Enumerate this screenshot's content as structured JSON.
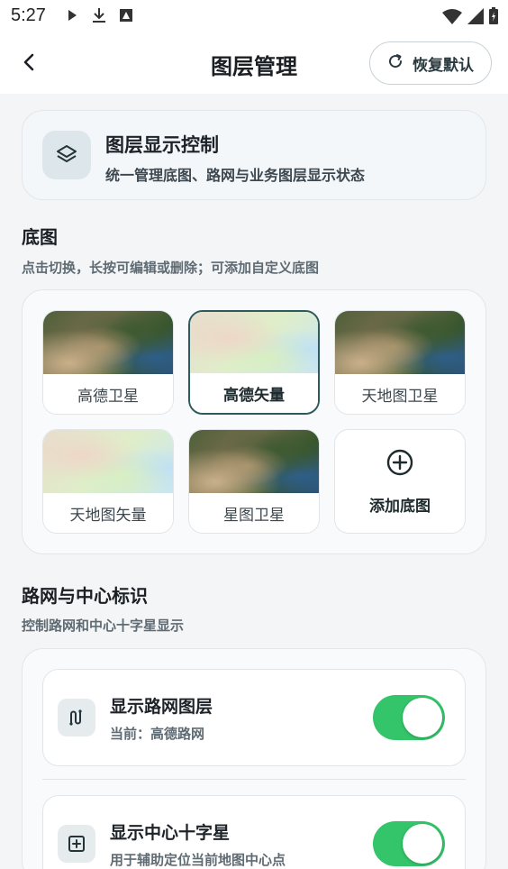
{
  "status_bar": {
    "time": "5:27"
  },
  "app_bar": {
    "title": "图层管理",
    "reset_label": "恢复默认"
  },
  "hero": {
    "title": "图层显示控制",
    "subtitle": "统一管理底图、路网与业务图层显示状态"
  },
  "basemap_section": {
    "title": "底图",
    "subtitle": "点击切换，长按可编辑或删除；可添加自定义底图",
    "tiles": [
      {
        "label": "高德卫星",
        "style": "satellite",
        "selected": false
      },
      {
        "label": "高德矢量",
        "style": "vector",
        "selected": true
      },
      {
        "label": "天地图卫星",
        "style": "satellite",
        "selected": false
      },
      {
        "label": "天地图矢量",
        "style": "vector",
        "selected": false
      },
      {
        "label": "星图卫星",
        "style": "satellite",
        "selected": false
      }
    ],
    "add_label": "添加底图"
  },
  "road_section": {
    "title": "路网与中心标识",
    "subtitle": "控制路网和中心十字星显示",
    "rows": [
      {
        "title": "显示路网图层",
        "subtitle": "当前：高德路网",
        "icon": "route-icon",
        "enabled": true
      },
      {
        "title": "显示中心十字星",
        "subtitle": "用于辅助定位当前地图中心点",
        "icon": "crosshair-box-icon",
        "enabled": true
      }
    ]
  },
  "colors": {
    "accent": "#2e5a5e",
    "switch_on": "#34c46a",
    "background": "#f4f5f7"
  }
}
